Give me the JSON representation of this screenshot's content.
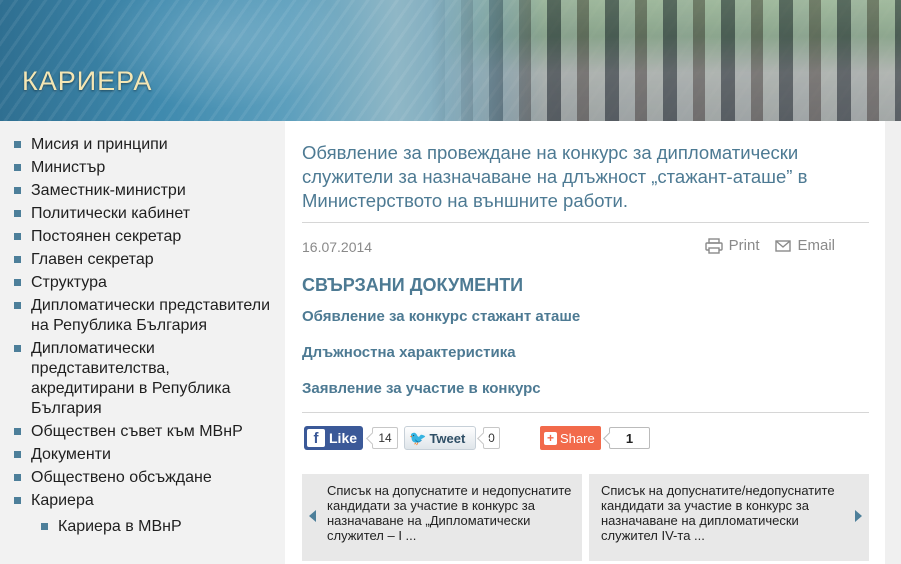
{
  "header": {
    "title": "КАРИЕРА"
  },
  "sidebar": {
    "items": [
      {
        "label": "Мисия и принципи"
      },
      {
        "label": "Министър"
      },
      {
        "label": "Заместник-министри"
      },
      {
        "label": "Политически кабинет"
      },
      {
        "label": "Постоянен секретар"
      },
      {
        "label": "Главен секретар"
      },
      {
        "label": "Структура"
      },
      {
        "label": "Дипломатически представители на Република България"
      },
      {
        "label": "Дипломатически представителства, акредитирани в Република България"
      },
      {
        "label": "Обществен съвет към МВнР"
      },
      {
        "label": "Документи"
      },
      {
        "label": "Обществено обсъждане"
      },
      {
        "label": "Кариера"
      }
    ],
    "subitems": [
      {
        "label": "Кариера в МВнР"
      }
    ]
  },
  "article": {
    "headline": "Обявление за провеждане на конкурс за дипломатически служители за назначаване на длъжност „стажант-аташе” в Министерството на външните работи.",
    "date": "16.07.2014",
    "print_label": "Print",
    "email_label": "Email",
    "related_title": "СВЪРЗАНИ ДОКУМЕНТИ",
    "documents": [
      {
        "label": "Обявление за конкурс стажант аташе"
      },
      {
        "label": "Длъжностна характеристика"
      },
      {
        "label": "Заявление за участие в конкурс"
      }
    ]
  },
  "social": {
    "like_label": "Like",
    "like_count": "14",
    "tweet_label": "Tweet",
    "tweet_count": "0",
    "share_label": "Share",
    "share_count": "1"
  },
  "pager": {
    "prev_text": "Списък на допуснатите и недопуснатите кандидати за участие в конкурс за назначаване на „Дипломатически служител – I ...",
    "next_text": "Списък на допуснатите/недопуснатите кандидати за участие в конкурс за назначаване на дипломатически служител IV-та ..."
  },
  "colors": {
    "accent": "#4d7a93",
    "facebook": "#3b5998",
    "share": "#f26a4b"
  }
}
